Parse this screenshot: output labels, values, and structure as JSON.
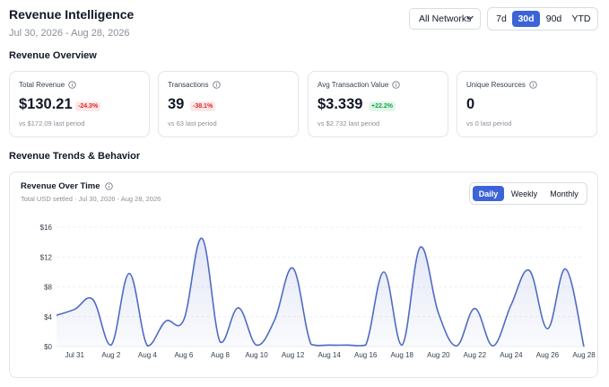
{
  "header": {
    "title": "Revenue Intelligence",
    "date_range": "Jul 30, 2026 - Aug 28, 2026"
  },
  "controls": {
    "network": "All Networks",
    "periods": [
      "7d",
      "30d",
      "90d",
      "YTD"
    ],
    "active_period": "30d"
  },
  "overview": {
    "title": "Revenue Overview",
    "cards": [
      {
        "label": "Total Revenue",
        "value": "$130.21",
        "badge": "-24.3%",
        "badge_type": "negative",
        "compare": "vs $172.09 last period"
      },
      {
        "label": "Transactions",
        "value": "39",
        "badge": "-38.1%",
        "badge_type": "negative",
        "compare": "vs 63 last period"
      },
      {
        "label": "Avg Transaction Value",
        "value": "$3.339",
        "badge": "+22.2%",
        "badge_type": "positive",
        "compare": "vs $2.732 last period"
      },
      {
        "label": "Unique Resources",
        "value": "0",
        "badge": "",
        "badge_type": "none",
        "compare": "vs 0 last period"
      }
    ]
  },
  "trends": {
    "title": "Revenue Trends & Behavior",
    "chart_title": "Revenue Over Time",
    "chart_subtitle": "Total USD settled · Jul 30, 2026 - Aug 28, 2026",
    "granularity": [
      "Daily",
      "Weekly",
      "Monthly"
    ],
    "active_granularity": "Daily"
  },
  "colors": {
    "accent": "#3c64d8",
    "line": "#4f6bc4",
    "negative": "#dc2626",
    "positive": "#16a34a"
  },
  "chart_data": {
    "type": "area",
    "x": [
      "Jul 30",
      "Jul 31",
      "Aug 1",
      "Aug 2",
      "Aug 3",
      "Aug 4",
      "Aug 5",
      "Aug 6",
      "Aug 7",
      "Aug 8",
      "Aug 9",
      "Aug 10",
      "Aug 11",
      "Aug 12",
      "Aug 13",
      "Aug 14",
      "Aug 15",
      "Aug 16",
      "Aug 17",
      "Aug 18",
      "Aug 19",
      "Aug 20",
      "Aug 21",
      "Aug 22",
      "Aug 23",
      "Aug 24",
      "Aug 25",
      "Aug 26",
      "Aug 27",
      "Aug 28"
    ],
    "values": [
      4.2,
      5.0,
      6.3,
      0.2,
      9.8,
      0.1,
      3.4,
      3.6,
      14.5,
      0.6,
      5.2,
      0.2,
      3.6,
      10.5,
      0.3,
      0.2,
      0.2,
      0.2,
      10.0,
      0.2,
      13.3,
      4.5,
      0.1,
      5.1,
      0.1,
      5.6,
      10.2,
      2.4,
      10.4,
      0.0
    ],
    "x_tick_labels": [
      "Jul 31",
      "Aug 2",
      "Aug 4",
      "Aug 6",
      "Aug 8",
      "Aug 10",
      "Aug 12",
      "Aug 14",
      "Aug 16",
      "Aug 18",
      "Aug 20",
      "Aug 22",
      "Aug 24",
      "Aug 26",
      "Aug 28"
    ],
    "y_ticks": [
      "$0",
      "$4",
      "$8",
      "$12",
      "$16"
    ],
    "ylim": [
      0,
      16
    ],
    "grid": true
  }
}
